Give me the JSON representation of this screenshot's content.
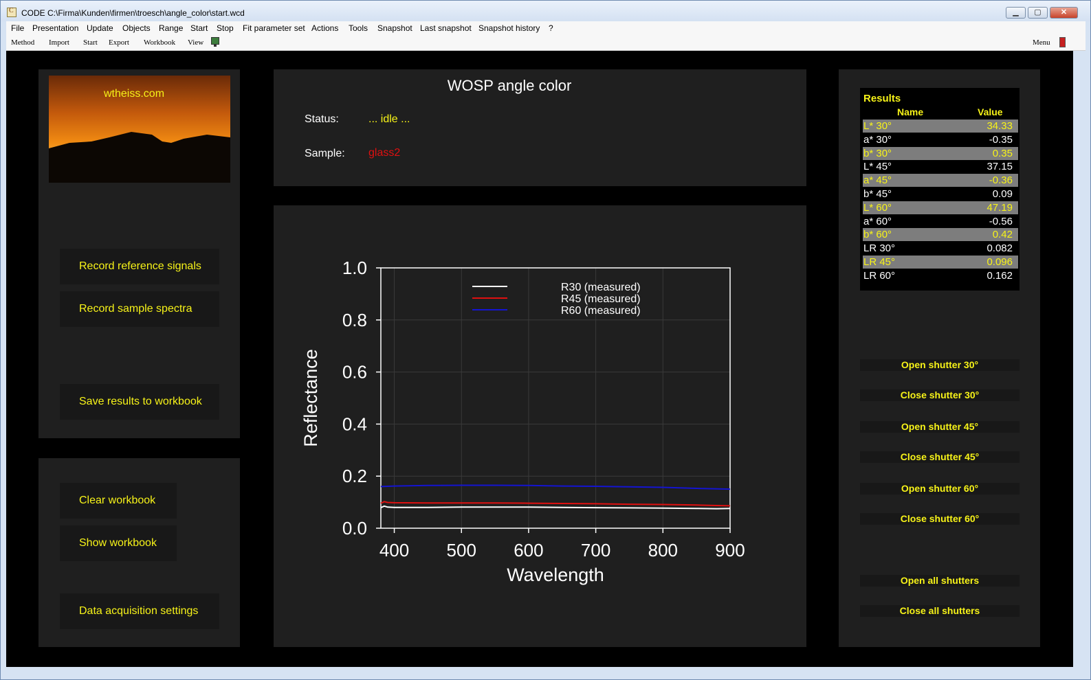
{
  "window": {
    "title": "CODE C:\\Firma\\Kunden\\firmen\\troesch\\angle_color\\start.wcd",
    "minimize_glyph": "▁",
    "maximize_glyph": "▢",
    "close_glyph": "✕"
  },
  "menubar": [
    "File",
    "Presentation",
    "Update",
    "Objects",
    "Range",
    "Start",
    "Stop",
    "Fit parameter set",
    "Actions",
    "Tools",
    "Snapshot",
    "Last snapshot",
    "Snapshot history",
    "?"
  ],
  "toolbar": {
    "items": [
      "Method",
      "Import",
      "Start",
      "Export",
      "Workbook",
      "View"
    ],
    "menu_label": "Menu"
  },
  "left_panel": {
    "logo_text": "wtheiss.com",
    "buttons": [
      "Record reference signals",
      "Record sample spectra",
      "Save results to workbook"
    ],
    "buttons2": [
      "Clear workbook",
      "Show workbook",
      "Data acquisition settings"
    ]
  },
  "info": {
    "title": "WOSP angle color",
    "status_label": "Status:",
    "status_value": "... idle ...",
    "sample_label": "Sample:",
    "sample_value": "glass2",
    "sample_color": "#e01010"
  },
  "chart_data": {
    "type": "line",
    "xlabel": "Wavelength",
    "ylabel": "Reflectance",
    "xlim": [
      380,
      900
    ],
    "ylim": [
      0,
      1.0
    ],
    "xticks": [
      400,
      500,
      600,
      700,
      800,
      900
    ],
    "yticks": [
      "0.0",
      "0.2",
      "0.4",
      "0.6",
      "0.8",
      "1.0"
    ],
    "grid": true,
    "legend": "top-center",
    "series": [
      {
        "name": "R30 (measured)",
        "color": "#ffffff",
        "x": [
          380,
          385,
          390,
          400,
          450,
          500,
          550,
          600,
          650,
          700,
          750,
          800,
          850,
          880,
          900
        ],
        "y": [
          0.079,
          0.085,
          0.081,
          0.08,
          0.08,
          0.081,
          0.081,
          0.081,
          0.08,
          0.079,
          0.078,
          0.077,
          0.076,
          0.075,
          0.076
        ]
      },
      {
        "name": "R45 (measured)",
        "color": "#e01010",
        "x": [
          380,
          385,
          390,
          400,
          450,
          500,
          550,
          600,
          650,
          700,
          750,
          800,
          850,
          880,
          900
        ],
        "y": [
          0.096,
          0.102,
          0.099,
          0.098,
          0.097,
          0.097,
          0.097,
          0.096,
          0.095,
          0.094,
          0.092,
          0.091,
          0.089,
          0.087,
          0.086
        ]
      },
      {
        "name": "R60 (measured)",
        "color": "#1414d2",
        "x": [
          380,
          400,
          450,
          500,
          550,
          600,
          650,
          700,
          750,
          800,
          850,
          900
        ],
        "y": [
          0.16,
          0.162,
          0.164,
          0.165,
          0.165,
          0.164,
          0.162,
          0.161,
          0.159,
          0.157,
          0.153,
          0.15
        ]
      }
    ]
  },
  "results": {
    "title": "Results",
    "col_name": "Name",
    "col_value": "Value",
    "rows": [
      {
        "name": "L* 30°",
        "value": "34.33"
      },
      {
        "name": "a* 30°",
        "value": "-0.35"
      },
      {
        "name": "b* 30°",
        "value": "0.35"
      },
      {
        "name": "L* 45°",
        "value": "37.15"
      },
      {
        "name": "a* 45°",
        "value": "-0.36"
      },
      {
        "name": "b* 45°",
        "value": "0.09"
      },
      {
        "name": "L* 60°",
        "value": "47.19"
      },
      {
        "name": "a* 60°",
        "value": "-0.56"
      },
      {
        "name": "b* 60°",
        "value": "0.42"
      },
      {
        "name": "LR 30°",
        "value": "0.082"
      },
      {
        "name": "LR 45°",
        "value": "0.096"
      },
      {
        "name": "LR 60°",
        "value": "0.162"
      }
    ]
  },
  "shutters": [
    "Open shutter 30°",
    "Close shutter 30°",
    "Open shutter 45°",
    "Close shutter 45°",
    "Open shutter 60°",
    "Close shutter 60°",
    "Open all shutters",
    "Close all shutters"
  ],
  "colors": {
    "accent_text": "#f7f318",
    "panel_bg": "#1f1f1f",
    "canvas_bg": "#000000"
  }
}
